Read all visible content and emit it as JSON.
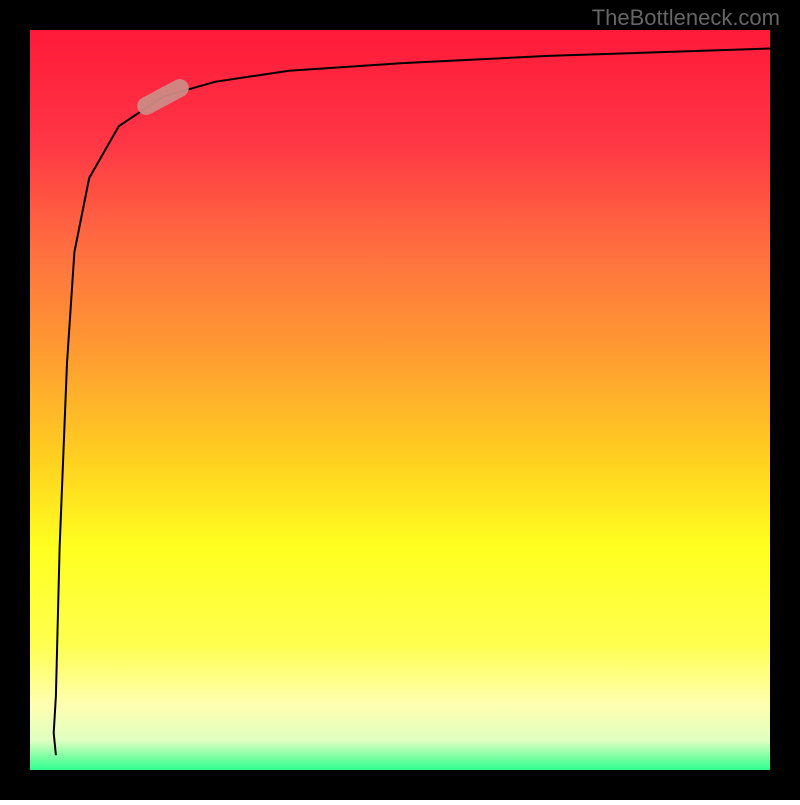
{
  "attribution": "TheBottleneck.com",
  "chart_data": {
    "type": "line",
    "title": "",
    "xlabel": "",
    "ylabel": "",
    "xlim": [
      0,
      100
    ],
    "ylim": [
      0,
      100
    ],
    "grid": false,
    "legend": false,
    "gradient_colors": {
      "top": "#ff1a3a",
      "mid_upper": "#ff6040",
      "mid": "#ffa030",
      "mid_lower": "#ffe020",
      "yellow": "#ffff30",
      "light_yellow": "#ffffaa",
      "bottom": "#30ff90"
    },
    "curve": {
      "description": "Logarithmic curve from bottom-left corner rising steeply then leveling off near top",
      "points": [
        {
          "x": 3.5,
          "y": 2
        },
        {
          "x": 3.2,
          "y": 5
        },
        {
          "x": 3.5,
          "y": 10
        },
        {
          "x": 4,
          "y": 30
        },
        {
          "x": 5,
          "y": 55
        },
        {
          "x": 6,
          "y": 70
        },
        {
          "x": 8,
          "y": 80
        },
        {
          "x": 12,
          "y": 87
        },
        {
          "x": 18,
          "y": 91
        },
        {
          "x": 25,
          "y": 93
        },
        {
          "x": 35,
          "y": 94.5
        },
        {
          "x": 50,
          "y": 95.5
        },
        {
          "x": 70,
          "y": 96.5
        },
        {
          "x": 100,
          "y": 97.5
        }
      ]
    },
    "marker": {
      "description": "Light red/salmon elongated marker on the curve",
      "position": {
        "x": 18,
        "y": 91
      },
      "color": "#d88080",
      "angle": 30
    },
    "border_width": 30
  }
}
